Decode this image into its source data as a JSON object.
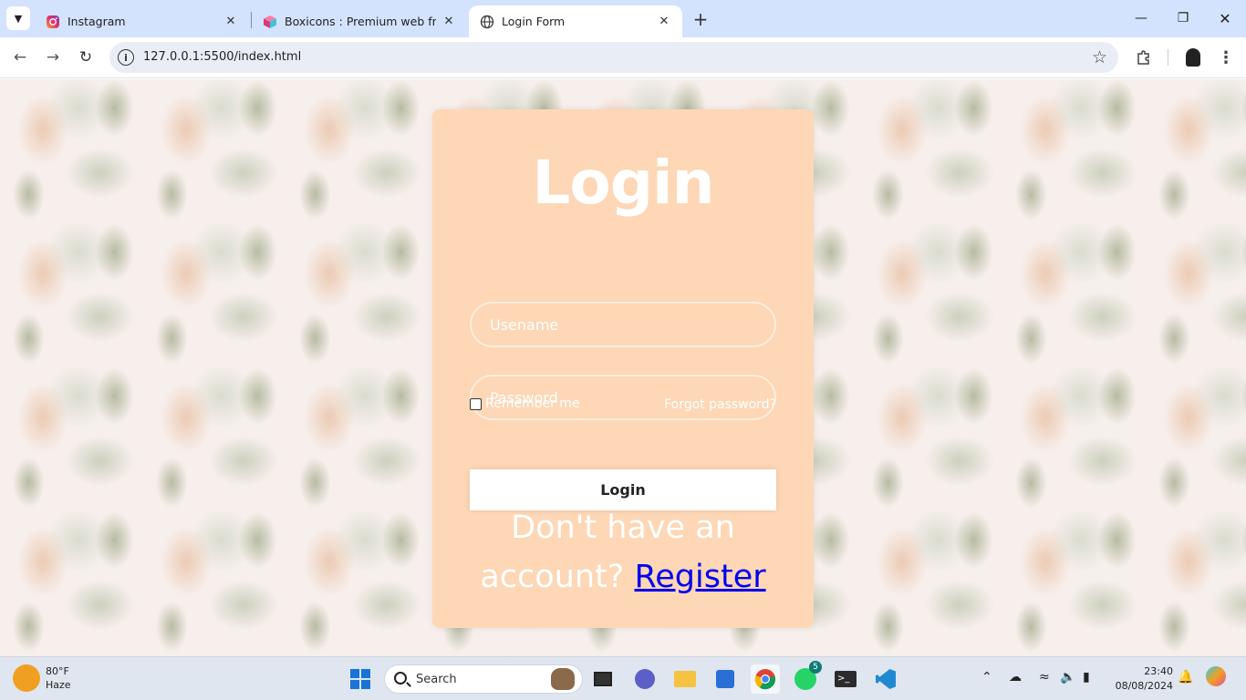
{
  "browser": {
    "tabs": [
      {
        "title": "Instagram",
        "icon": "instagram-icon"
      },
      {
        "title": "Boxicons : Premium web friendl",
        "icon": "boxicons-icon"
      },
      {
        "title": "Login Form",
        "icon": "globe-icon"
      }
    ],
    "url": "127.0.0.1:5500/index.html"
  },
  "login": {
    "title": "Login",
    "username_placeholder": "Usename",
    "password_placeholder": "Password",
    "remember_label": "Remember me",
    "forgot_label": "Forgot password?",
    "button_label": "Login",
    "register_prompt": "Don't have an account?",
    "register_link": "Register",
    "card_color": "#fdd7b6"
  },
  "taskbar": {
    "weather_temp": "80°F",
    "weather_desc": "Haze",
    "search_label": "Search",
    "whatsapp_badge": "5",
    "time": "23:40",
    "date": "08/08/2024"
  }
}
